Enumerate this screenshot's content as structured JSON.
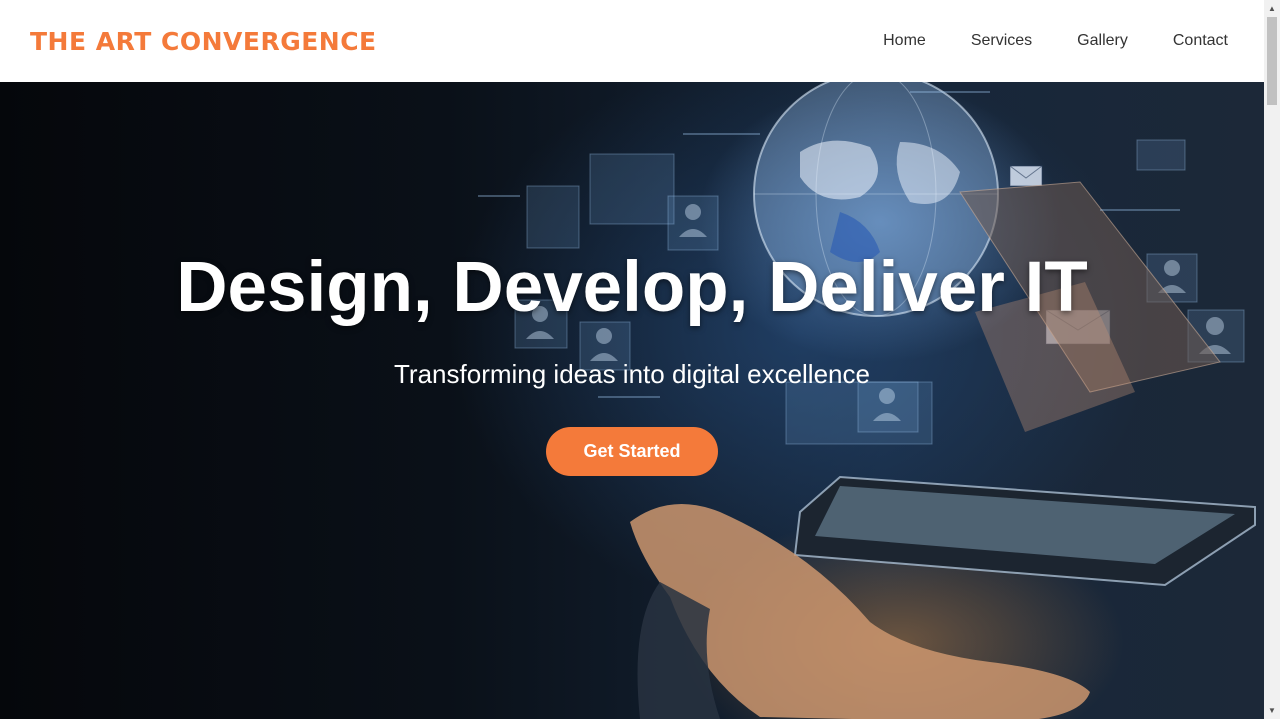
{
  "header": {
    "logo": "THE ART CONVERGENCE",
    "nav": [
      {
        "label": "Home"
      },
      {
        "label": "Services"
      },
      {
        "label": "Gallery"
      },
      {
        "label": "Contact"
      }
    ]
  },
  "hero": {
    "title": "Design, Develop, Deliver IT",
    "subtitle": "Transforming ideas into digital excellence",
    "cta_label": "Get Started"
  },
  "colors": {
    "accent": "#f47a3a",
    "header_bg": "#ffffff",
    "nav_text": "#333333"
  },
  "icons": [
    "globe-icon",
    "laptop-icon",
    "tablet-icon",
    "hand-image",
    "profile-icon",
    "mail-icon"
  ]
}
